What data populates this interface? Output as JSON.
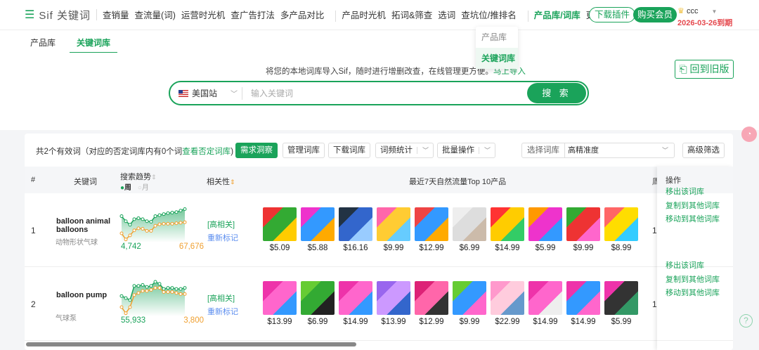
{
  "nav": {
    "logo": "Sif 关键词",
    "items": [
      "查销量",
      "查流量(词)",
      "运营时光机",
      "查广告打法",
      "多产品对比",
      "产品时光机",
      "拓词&筛查",
      "选词",
      "查坑位/推排名",
      "产品库/词库",
      "更多"
    ],
    "download": "下载插件",
    "buy": "购买会员",
    "user": "ccc",
    "expiry": "2026-03-26到期"
  },
  "subtabs": [
    "产品库",
    "关键词库"
  ],
  "dropdown": [
    "产品库",
    "关键词库"
  ],
  "hero": {
    "hint": "将您的本地词库导入Sif，随时进行增删改查，在线管理更方便。",
    "hint_link": "马上导入",
    "old_version": "回到旧版",
    "site": "美国站",
    "placeholder": "输入关键词",
    "search": "搜 索"
  },
  "toolbar": {
    "count": "共2个有效词（对应的否定词库内有0个词",
    "count_link": "查看否定词库",
    "count_end": ")",
    "insight": "需求洞察",
    "manage": "管理词库",
    "download": "下载词库",
    "freq": "词频统计",
    "batch": "批量操作",
    "select_label": "选择词库",
    "select_value": "高精准度",
    "advanced": "高级筛选"
  },
  "table": {
    "headers": {
      "num": "#",
      "keyword": "关键词",
      "trend": "搜索趋势",
      "week": "周",
      "month": "月",
      "relevance": "相关性",
      "products": "最近7天自然流量Top 10产品",
      "truncated": "周",
      "ops": "操作"
    },
    "rows": [
      {
        "num": "1",
        "keyword": "balloon animal balloons",
        "keyword_cn": "动物形状气球",
        "v1": "4,742",
        "v2": "67,676",
        "green": [
          72,
          62,
          55,
          66,
          68,
          66,
          62,
          61,
          72,
          74,
          76,
          78,
          79,
          80,
          83,
          86
        ],
        "orange": [
          38,
          26,
          34,
          44,
          48,
          47,
          43,
          43,
          53,
          56,
          57,
          57,
          57,
          58,
          59,
          60
        ],
        "relevance": "[高相关]",
        "remark": "重新标记",
        "trunc": "1,",
        "prices": [
          "$5.09",
          "$5.88",
          "$16.16",
          "$9.99",
          "$12.99",
          "$6.99",
          "$14.99",
          "$5.99",
          "$9.99",
          "$8.99"
        ],
        "colors": [
          [
            "#e33",
            "#3a3",
            "#fc0"
          ],
          [
            "#e3c",
            "#39f",
            "#fa0"
          ],
          [
            "#234",
            "#36c",
            "#9cf"
          ],
          [
            "#f6a",
            "#fc3",
            "#6cf"
          ],
          [
            "#e44",
            "#39f",
            "#fa0"
          ],
          [
            "#eee",
            "#ddd",
            "#cba"
          ],
          [
            "#f33",
            "#fc0",
            "#3c6"
          ],
          [
            "#f90",
            "#e3c",
            "#39f"
          ],
          [
            "#3a3",
            "#e33",
            "#f6c"
          ],
          [
            "#f66",
            "#fd0",
            "#3cf"
          ]
        ],
        "ops": [
          "移出该词库",
          "复制到其他词库",
          "移动到其他词库"
        ]
      },
      {
        "num": "2",
        "keyword": "balloon pump",
        "keyword_cn": "气球泵",
        "v1": "55,933",
        "v2": "3,800",
        "green": [
          60,
          56,
          52,
          80,
          80,
          82,
          78,
          80,
          88,
          84,
          74,
          76,
          76,
          74,
          74,
          76
        ],
        "orange": [
          38,
          26,
          38,
          62,
          66,
          70,
          70,
          72,
          76,
          76,
          68,
          68,
          68,
          66,
          64,
          64
        ],
        "relevance": "[高相关]",
        "remark": "重新标记",
        "trunc": "1",
        "prices": [
          "$13.99",
          "$6.99",
          "$14.99",
          "$13.99",
          "$12.99",
          "$9.99",
          "$22.99",
          "$14.99",
          "$14.99",
          "$5.99"
        ],
        "colors": [
          [
            "#e3a",
            "#f6c",
            "#39f"
          ],
          [
            "#6c3",
            "#3a3",
            "#222"
          ],
          [
            "#e3a",
            "#f6c",
            "#39f"
          ],
          [
            "#96e",
            "#c9f",
            "#36c"
          ],
          [
            "#d27",
            "#f6a",
            "#333"
          ],
          [
            "#6c3",
            "#39f",
            "#f6c"
          ],
          [
            "#f9c",
            "#fcd",
            "#69c"
          ],
          [
            "#e3a",
            "#f6c",
            "#eee"
          ],
          [
            "#e3a",
            "#39f",
            "#f6c"
          ],
          [
            "#e3a",
            "#333",
            "#396"
          ]
        ],
        "ops": [
          "移出该词库",
          "复制到其他词库",
          "移动到其他词库"
        ]
      }
    ]
  },
  "help": "?"
}
